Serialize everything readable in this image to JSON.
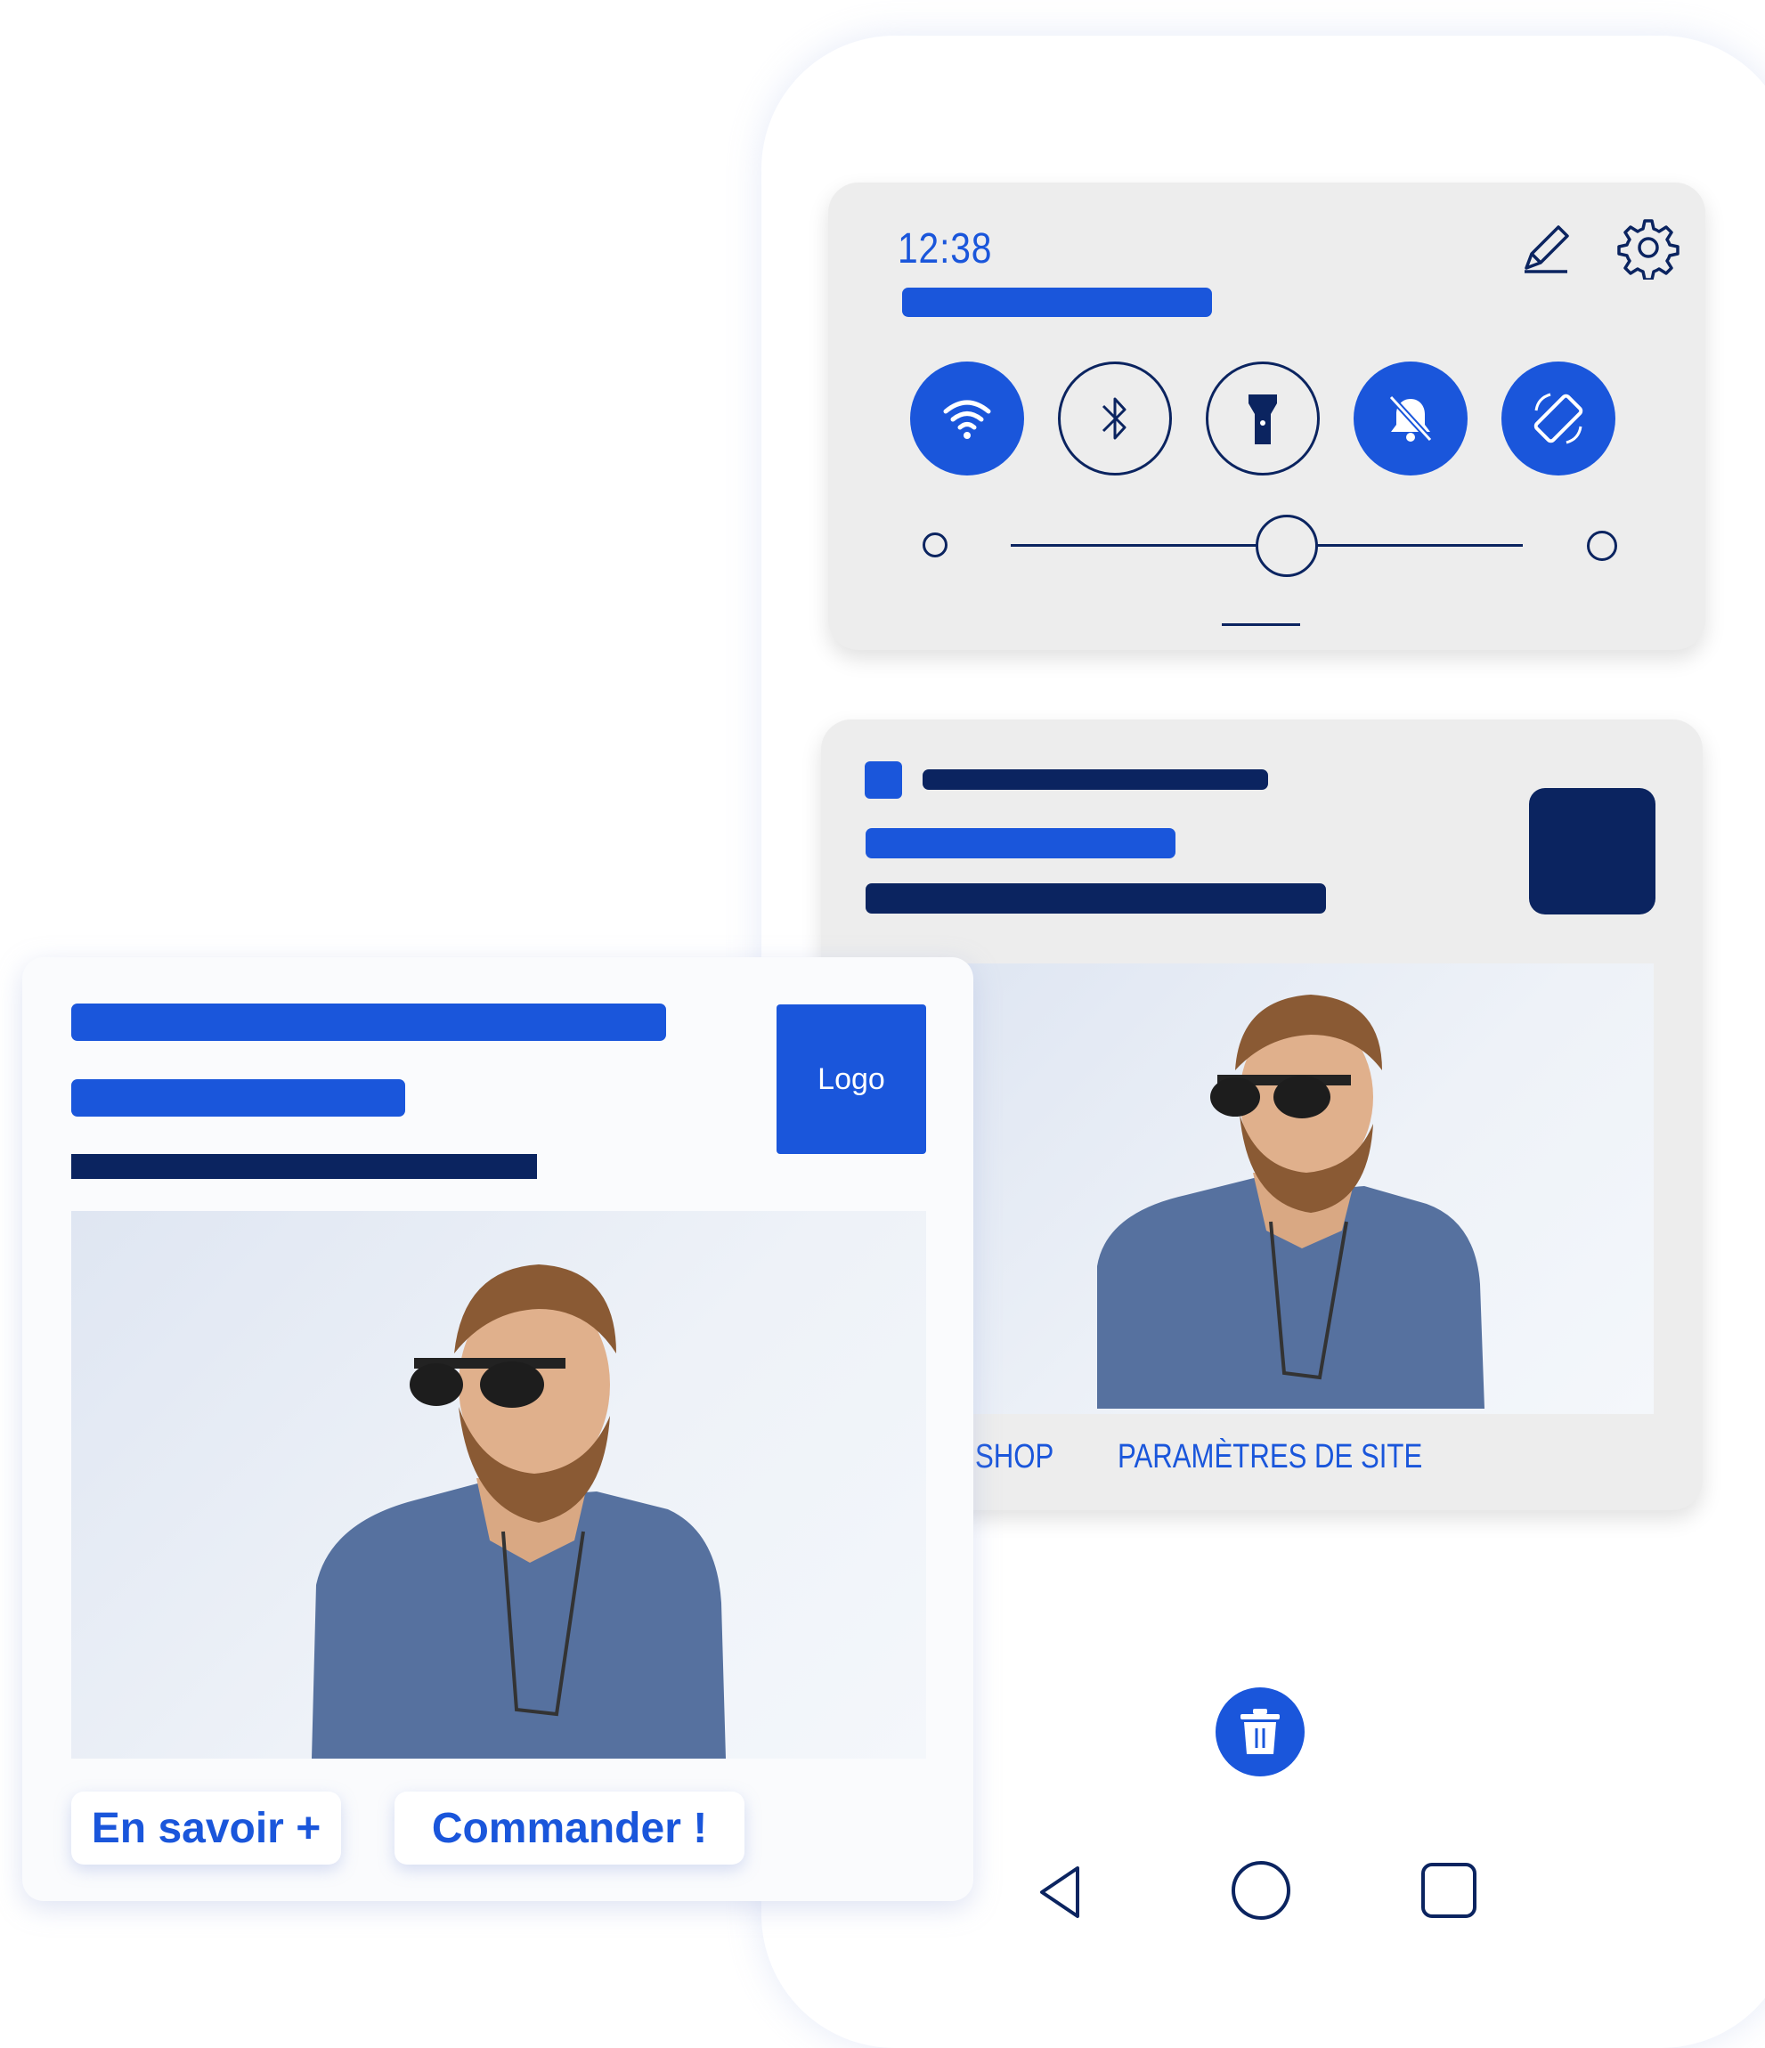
{
  "status": {
    "time": "12:38"
  },
  "quick_settings": {
    "icons": [
      "edit-icon",
      "gear-icon"
    ],
    "toggles": [
      {
        "name": "wifi",
        "state": "on"
      },
      {
        "name": "bluetooth",
        "state": "off"
      },
      {
        "name": "flashlight",
        "state": "off"
      },
      {
        "name": "do-not-disturb",
        "state": "on"
      },
      {
        "name": "auto-rotate",
        "state": "on"
      }
    ],
    "brightness_level": 0.54
  },
  "notification": {
    "actions": [
      "SHOP",
      "PARAMÈTRES DE SITE"
    ]
  },
  "page_card": {
    "logo_label": "Logo",
    "buttons": {
      "learn_more": "En savoir +",
      "order": "Commander !"
    }
  },
  "colors": {
    "accent": "#1a56db",
    "navy": "#0b2460",
    "panel": "#ededed"
  }
}
